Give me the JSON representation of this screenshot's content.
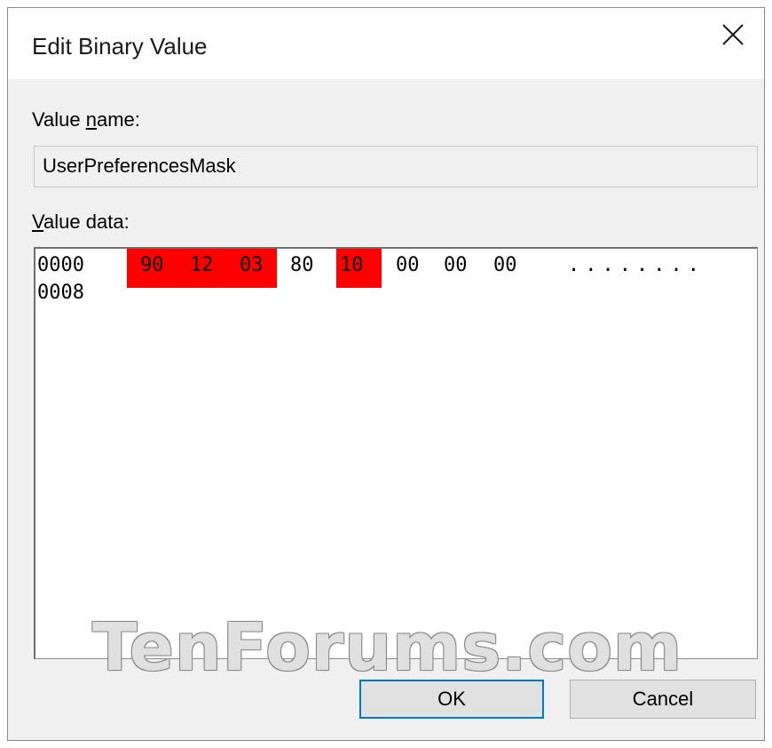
{
  "dialog": {
    "title": "Edit Binary Value",
    "close_icon": "close-icon"
  },
  "value_name": {
    "label_prefix": "Value ",
    "label_access": "n",
    "label_rest": "ame:",
    "value": "UserPreferencesMask"
  },
  "value_data": {
    "label_access": "V",
    "label_rest": "alue data:",
    "rows": [
      {
        "offset": "0000",
        "bytes": [
          "90",
          "12",
          "03",
          "80",
          "10",
          "00",
          "00",
          "00"
        ],
        "ascii": "........"
      },
      {
        "offset": "0008",
        "bytes": [],
        "ascii": ""
      }
    ],
    "highlight_color": "#ff0000"
  },
  "buttons": {
    "ok": "OK",
    "cancel": "Cancel"
  },
  "watermark": "TenForums.com"
}
